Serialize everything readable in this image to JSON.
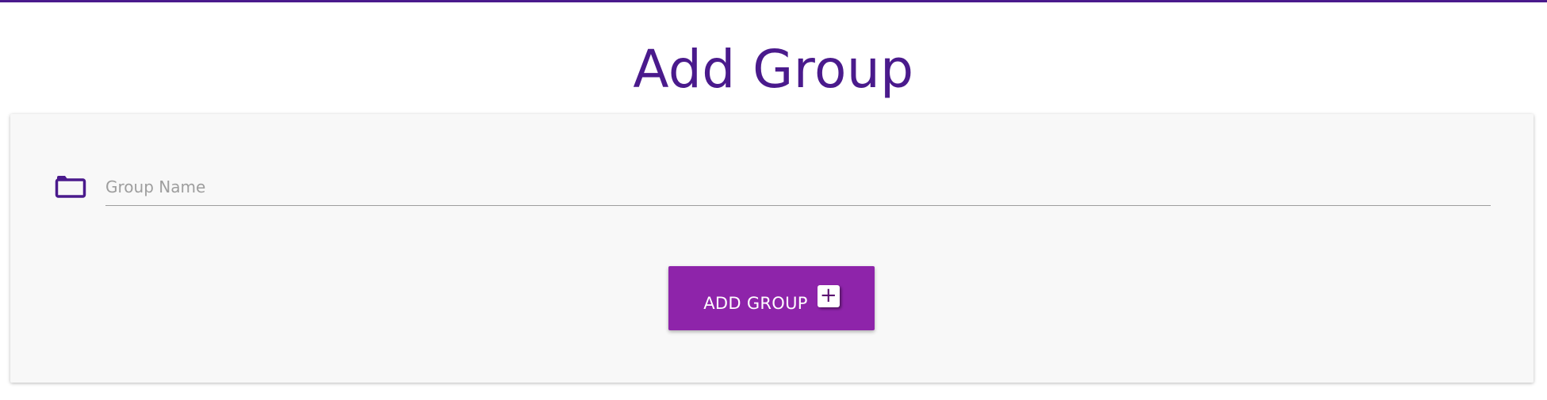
{
  "page": {
    "title": "Add Group",
    "accent_color": "#4a1a8c",
    "button_color": "#8e24aa"
  },
  "form": {
    "group_name": {
      "icon": "folder-icon",
      "value": "",
      "placeholder": "Group Name"
    },
    "submit": {
      "label": "ADD GROUP",
      "icon": "plus-icon",
      "icon_glyph": "+"
    }
  }
}
